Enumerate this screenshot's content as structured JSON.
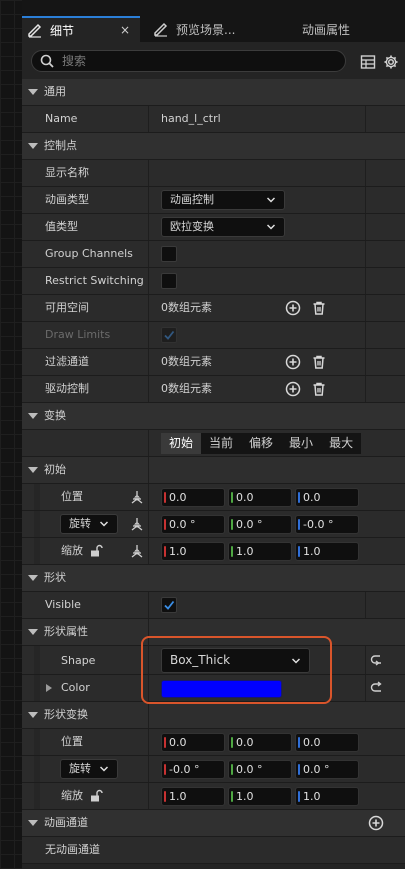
{
  "tabs": [
    {
      "label": "细节",
      "close": "×"
    },
    {
      "label": "预览场景..."
    },
    {
      "label": "动画属性"
    }
  ],
  "search": {
    "placeholder": "搜索"
  },
  "colors": {
    "accent": "#2b7fd8",
    "x_axis": "#c83232",
    "y_axis": "#4fa843",
    "z_axis": "#2f6fd8",
    "shape_color": "#0000ff",
    "highlight": "#d9552b"
  },
  "sections": {
    "general": "通用",
    "control_point": "控制点",
    "transform": "变换",
    "initial": "初始",
    "shape": "形状",
    "shape_props": "形状属性",
    "shape_transform": "形状变换",
    "anim_channels": "动画通道"
  },
  "general": {
    "name_label": "Name",
    "name_value": "hand_l_ctrl"
  },
  "control": {
    "display_name": "显示名称",
    "anim_type_label": "动画类型",
    "anim_type_value": "动画控制",
    "value_type_label": "值类型",
    "value_type_value": "欧拉变换",
    "group_channels": "Group Channels",
    "restrict_switching": "Restrict Switching",
    "available_space": "可用空间",
    "available_space_value": "0数组元素",
    "draw_limits": "Draw Limits",
    "filter_channels": "过滤通道",
    "filter_channels_value": "0数组元素",
    "driven_controls": "驱动控制",
    "driven_controls_value": "0数组元素"
  },
  "transform": {
    "tabs": [
      "初始",
      "当前",
      "偏移",
      "最小",
      "最大"
    ],
    "position": "位置",
    "rotation": "旋转",
    "scale": "缩放"
  },
  "initial": {
    "location": [
      "0.0",
      "0.0",
      "0.0"
    ],
    "rotation": [
      "0.0 °",
      "0.0 °",
      "-0.0 °"
    ],
    "scale": [
      "1.0",
      "1.0",
      "1.0"
    ]
  },
  "shape": {
    "visible": "Visible",
    "shape_label": "Shape",
    "shape_value": "Box_Thick",
    "color_label": "Color"
  },
  "shape_transform": {
    "position": "位置",
    "rotation": "旋转",
    "scale": "缩放",
    "location": [
      "0.0",
      "0.0",
      "0.0"
    ],
    "rotation_values": [
      "-0.0 °",
      "0.0 °",
      "0.0 °"
    ],
    "scale_values": [
      "1.0",
      "1.0",
      "1.0"
    ]
  },
  "anim_channels": {
    "empty": "无动画通道"
  }
}
